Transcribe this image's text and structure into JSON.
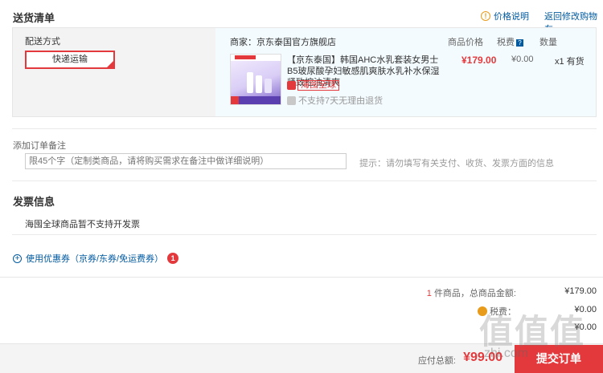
{
  "header": {
    "title": "送货清单",
    "price_help": "价格说明",
    "back_to_cart": "返回修改购物车"
  },
  "delivery": {
    "label": "配送方式",
    "method": "快递运输"
  },
  "goods": {
    "merchant": "商家：京东泰国官方旗舰店",
    "col_price": "商品价格",
    "col_tax": "税费",
    "col_qty": "数量",
    "name": "【京东泰国】韩国AHC水乳套装女男士B5玻尿酸孕妇敏感肌爽肤水乳补水保湿紧致控油清爽",
    "tag_global": "海囤全球",
    "tag_return": "不支持7天无理由退货",
    "price": "¥179.00",
    "tax": "¥0.00",
    "qty": "x1 有货"
  },
  "remark": {
    "label": "添加订单备注",
    "placeholder": "限45个字（定制类商品，请将购买需求在备注中做详细说明）",
    "tip": "提示：请勿填写有关支付、收货、发票方面的信息"
  },
  "invoice": {
    "title": "发票信息",
    "note": "海囤全球商品暂不支持开发票"
  },
  "coupon": {
    "label": "使用优惠券（京券/东券/免运费券）",
    "count": "1"
  },
  "summary": {
    "goods_count": "1",
    "goods_label": "件商品，总商品金额:",
    "goods_value": "¥179.00",
    "tax_label": "税费：",
    "tax_value": "¥0.00",
    "row3_value": "¥0.00",
    "total_label": "应付总额:",
    "total_value": "¥99.00",
    "submit": "提交订单"
  },
  "watermark": {
    "text": "值值值",
    "url": "zhi.com"
  },
  "colors": {
    "accent_red": "#e4393c",
    "link_blue": "#005aa0"
  }
}
